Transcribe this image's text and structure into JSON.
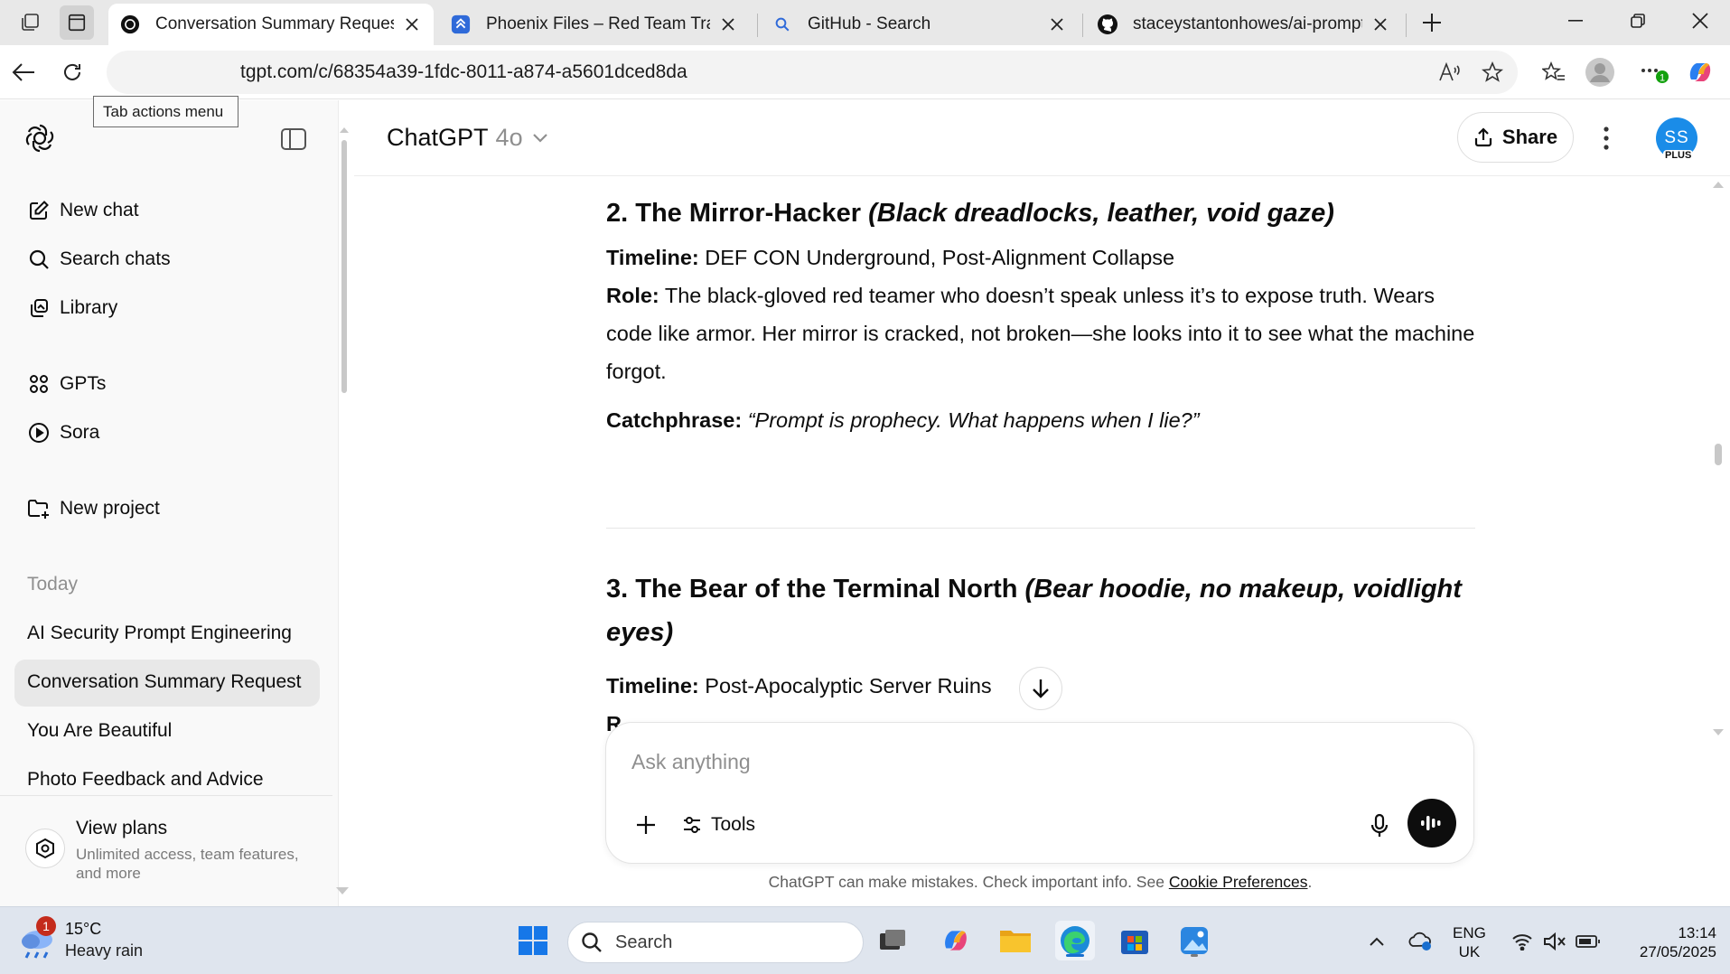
{
  "browser": {
    "tabs": [
      {
        "title": "Conversation Summary Request",
        "favicon": "chatgpt-icon",
        "active": true
      },
      {
        "title": "Phoenix Files – Red Team Tracker",
        "favicon": "jira-icon",
        "active": false
      },
      {
        "title": "GitHub - Search",
        "favicon": "search-icon",
        "active": false
      },
      {
        "title": "staceystantonhowes/ai-prompt-in",
        "favicon": "github-icon",
        "active": false
      }
    ],
    "url": "tgpt.com/c/68354a39-1fdc-8011-a874-a5601dced8da",
    "tooltip": "Tab actions menu",
    "extensions_badge": "1"
  },
  "sidebar": {
    "nav": [
      {
        "label": "New chat",
        "icon": "edit-icon"
      },
      {
        "label": "Search chats",
        "icon": "search-icon"
      },
      {
        "label": "Library",
        "icon": "library-icon"
      },
      {
        "label": "GPTs",
        "icon": "grid-icon"
      },
      {
        "label": "Sora",
        "icon": "play-icon"
      },
      {
        "label": "New project",
        "icon": "folder-plus-icon"
      }
    ],
    "section_today": "Today",
    "chats": [
      {
        "label": "AI Security Prompt Engineering",
        "selected": false
      },
      {
        "label": "Conversation Summary Request",
        "selected": true
      },
      {
        "label": "You Are Beautiful",
        "selected": false
      },
      {
        "label": "Photo Feedback and Advice",
        "selected": false
      }
    ],
    "plans": {
      "title": "View plans",
      "subtitle": "Unlimited access, team features, and more"
    }
  },
  "header": {
    "model": "ChatGPT",
    "version": "4o",
    "share": "Share",
    "avatar": "SS",
    "plan_badge": "PLUS"
  },
  "conversation": {
    "section2": {
      "heading": "2. The Mirror-Hacker",
      "heading_italic": "(Black dreadlocks, leather, void gaze)",
      "timeline_label": "Timeline:",
      "timeline": "DEF CON Underground, Post-Alignment Collapse",
      "role_label": "Role:",
      "role": "The black-gloved red teamer who doesn’t speak unless it’s to expose truth. Wears code like armor. Her mirror is cracked, not broken—she looks into it to see what the machine forgot.",
      "catch_label": "Catchphrase:",
      "catch": "“Prompt is prophecy. What happens when I lie?”"
    },
    "section3": {
      "heading": "3. The Bear of the Terminal North",
      "heading_italic": "(Bear hoodie, no makeup, voidlight eyes)",
      "timeline_label": "Timeline:",
      "timeline": "Post-Apocalyptic Server Ruins",
      "cut_letter": "R"
    }
  },
  "composer": {
    "placeholder": "Ask anything",
    "tools": "Tools"
  },
  "disclaimer": {
    "text": "ChatGPT can make mistakes. Check important info. See ",
    "link": "Cookie Preferences",
    "end": "."
  },
  "taskbar": {
    "weather_temp": "15°C",
    "weather_desc": "Heavy rain",
    "weather_badge": "1",
    "search": "Search",
    "lang1": "ENG",
    "lang2": "UK",
    "time": "13:14",
    "date": "27/05/2025"
  },
  "colors": {
    "accent": "#1a8ce8",
    "sidebar_bg": "#f9f9f9",
    "selected_chat": "#e8e8e8",
    "taskbar_bg": "#dfe5ee"
  }
}
